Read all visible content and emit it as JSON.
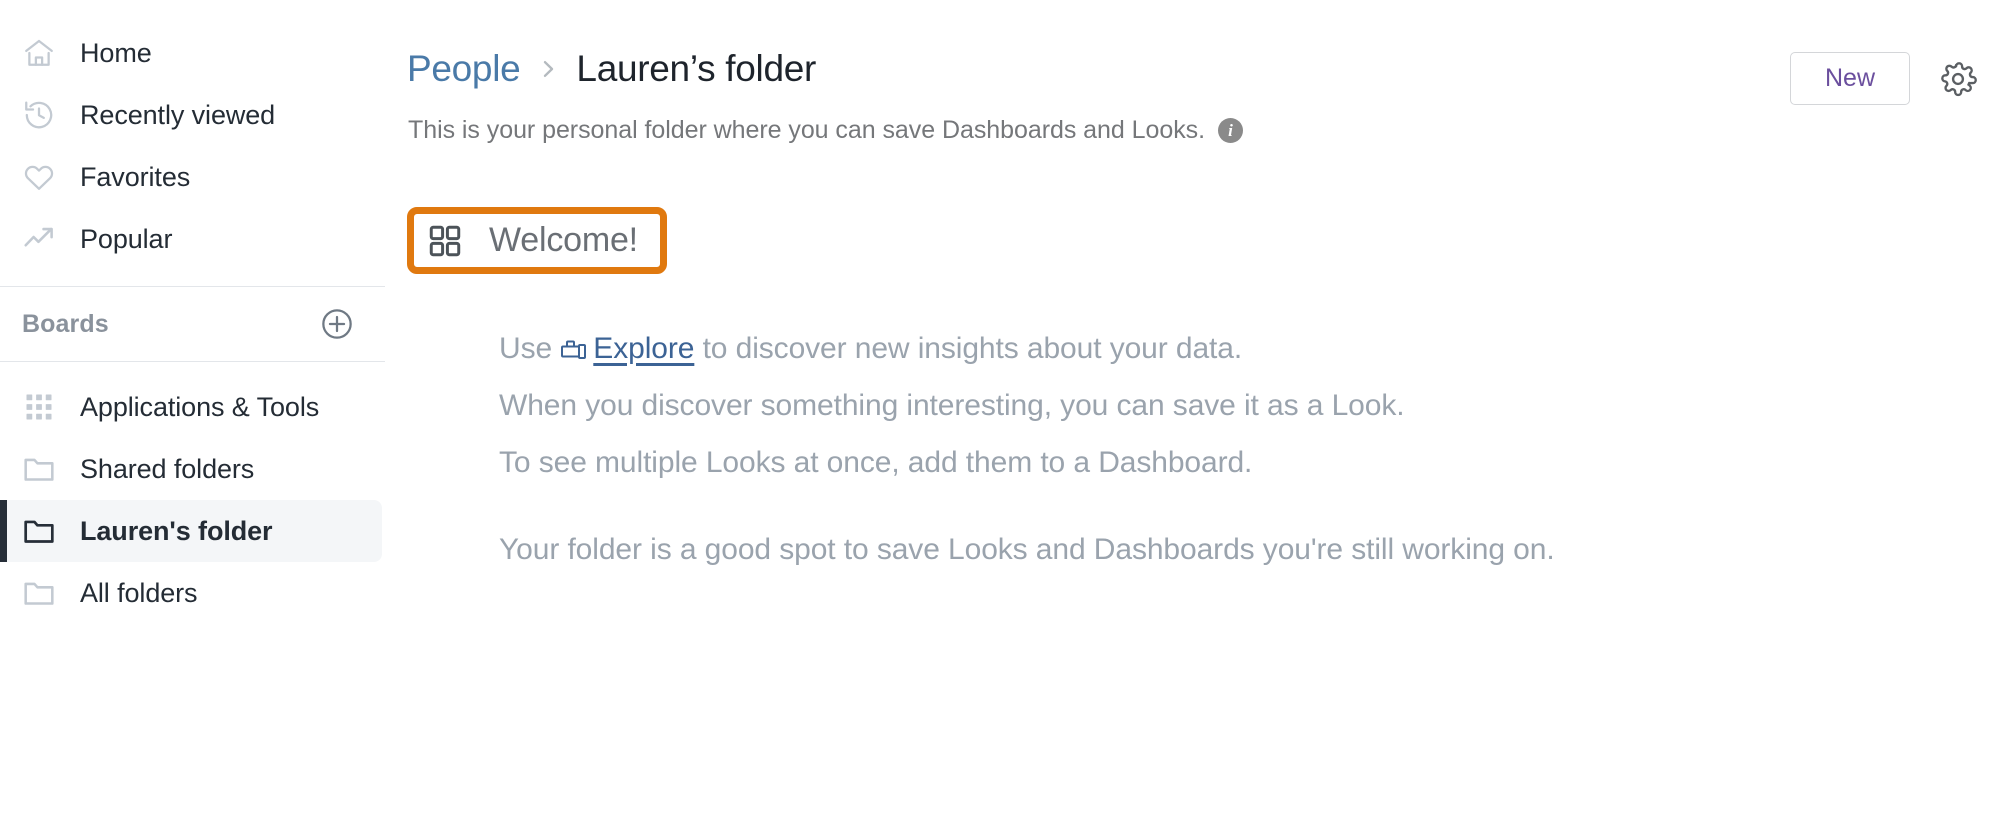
{
  "sidebar": {
    "primary_items": [
      {
        "label": "Home",
        "icon": "home-icon"
      },
      {
        "label": "Recently viewed",
        "icon": "history-icon"
      },
      {
        "label": "Favorites",
        "icon": "heart-icon"
      },
      {
        "label": "Popular",
        "icon": "trending-up-icon"
      }
    ],
    "section": {
      "title": "Boards",
      "add_icon": "plus-circle-icon"
    },
    "folder_items": [
      {
        "label": "Applications & Tools",
        "icon": "apps-grid-icon",
        "selected": false
      },
      {
        "label": "Shared folders",
        "icon": "folder-icon",
        "selected": false
      },
      {
        "label": "Lauren's folder",
        "icon": "folder-icon",
        "selected": true
      },
      {
        "label": "All folders",
        "icon": "folder-icon",
        "selected": false
      }
    ]
  },
  "header": {
    "breadcrumb_parent": "People",
    "breadcrumb_separator": "chevron-right-icon",
    "breadcrumb_current": "Lauren’s folder",
    "subtitle": "This is your personal folder where you can save Dashboards and Looks.",
    "info_glyph": "i",
    "new_button": "New",
    "settings_icon": "gear-icon"
  },
  "content": {
    "welcome": {
      "label": "Welcome!",
      "icon": "dashboard-grid-icon",
      "highlight_color": "#e0790f"
    },
    "lines": {
      "line1_before": "Use ",
      "line1_link": "Explore",
      "line1_after": " to discover new insights about your data.",
      "line2": "When you discover something interesting, you can save it as a Look.",
      "line3": "To see multiple Looks at once, add them to a Dashboard.",
      "line4": "Your folder is a good spot to save Looks and Dashboards you're still working on."
    }
  },
  "colors": {
    "link_blue": "#4a7aa8",
    "explore_blue": "#3c6395",
    "new_purple": "#6b4f9e",
    "highlight_orange": "#e0790f",
    "selected_bar": "#262e38",
    "selected_bg": "#f4f6f8",
    "body_gray": "#9aa3ad"
  }
}
